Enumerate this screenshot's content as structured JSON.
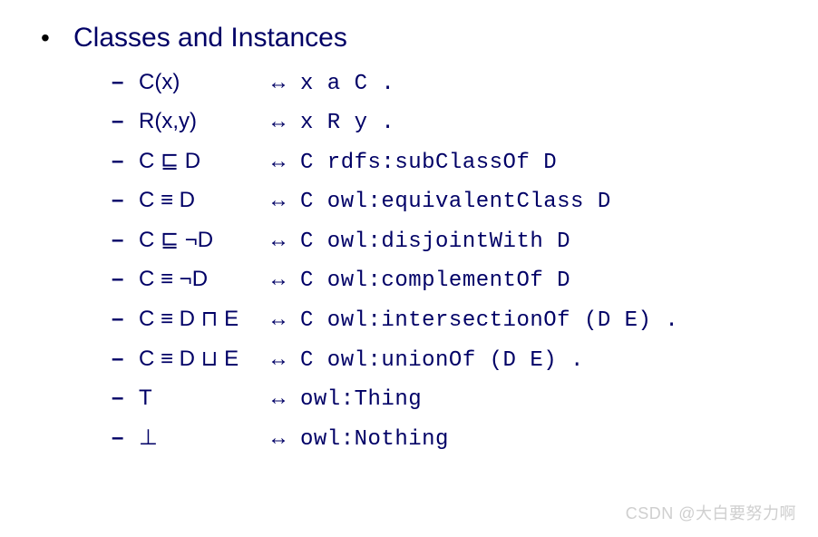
{
  "heading": "Classes and Instances",
  "items": [
    {
      "left": "C(x)",
      "right": "x a C ."
    },
    {
      "left": "R(x,y)",
      "right": " x R y ."
    },
    {
      "left": "C ⊑ D",
      "right": "C rdfs:subClassOf D"
    },
    {
      "left": "C ≡ D",
      "right": "C owl:equivalentClass D"
    },
    {
      "left": "C ⊑ ¬D",
      "right": "C owl:disjointWith D"
    },
    {
      "left": "C ≡ ¬D",
      "right": "C owl:complementOf D"
    },
    {
      "left": "C ≡ D ⊓ E",
      "right": "C owl:intersectionOf (D E) ."
    },
    {
      "left": "C ≡ D ⊔ E",
      "right": "C owl:unionOf (D E) ."
    },
    {
      "left": "T",
      "right": " owl:Thing"
    },
    {
      "left": "⊥",
      "right": " owl:Nothing"
    }
  ],
  "arrow": "↔",
  "dash": "–",
  "bullet": "•",
  "watermark": "CSDN @大白要努力啊"
}
